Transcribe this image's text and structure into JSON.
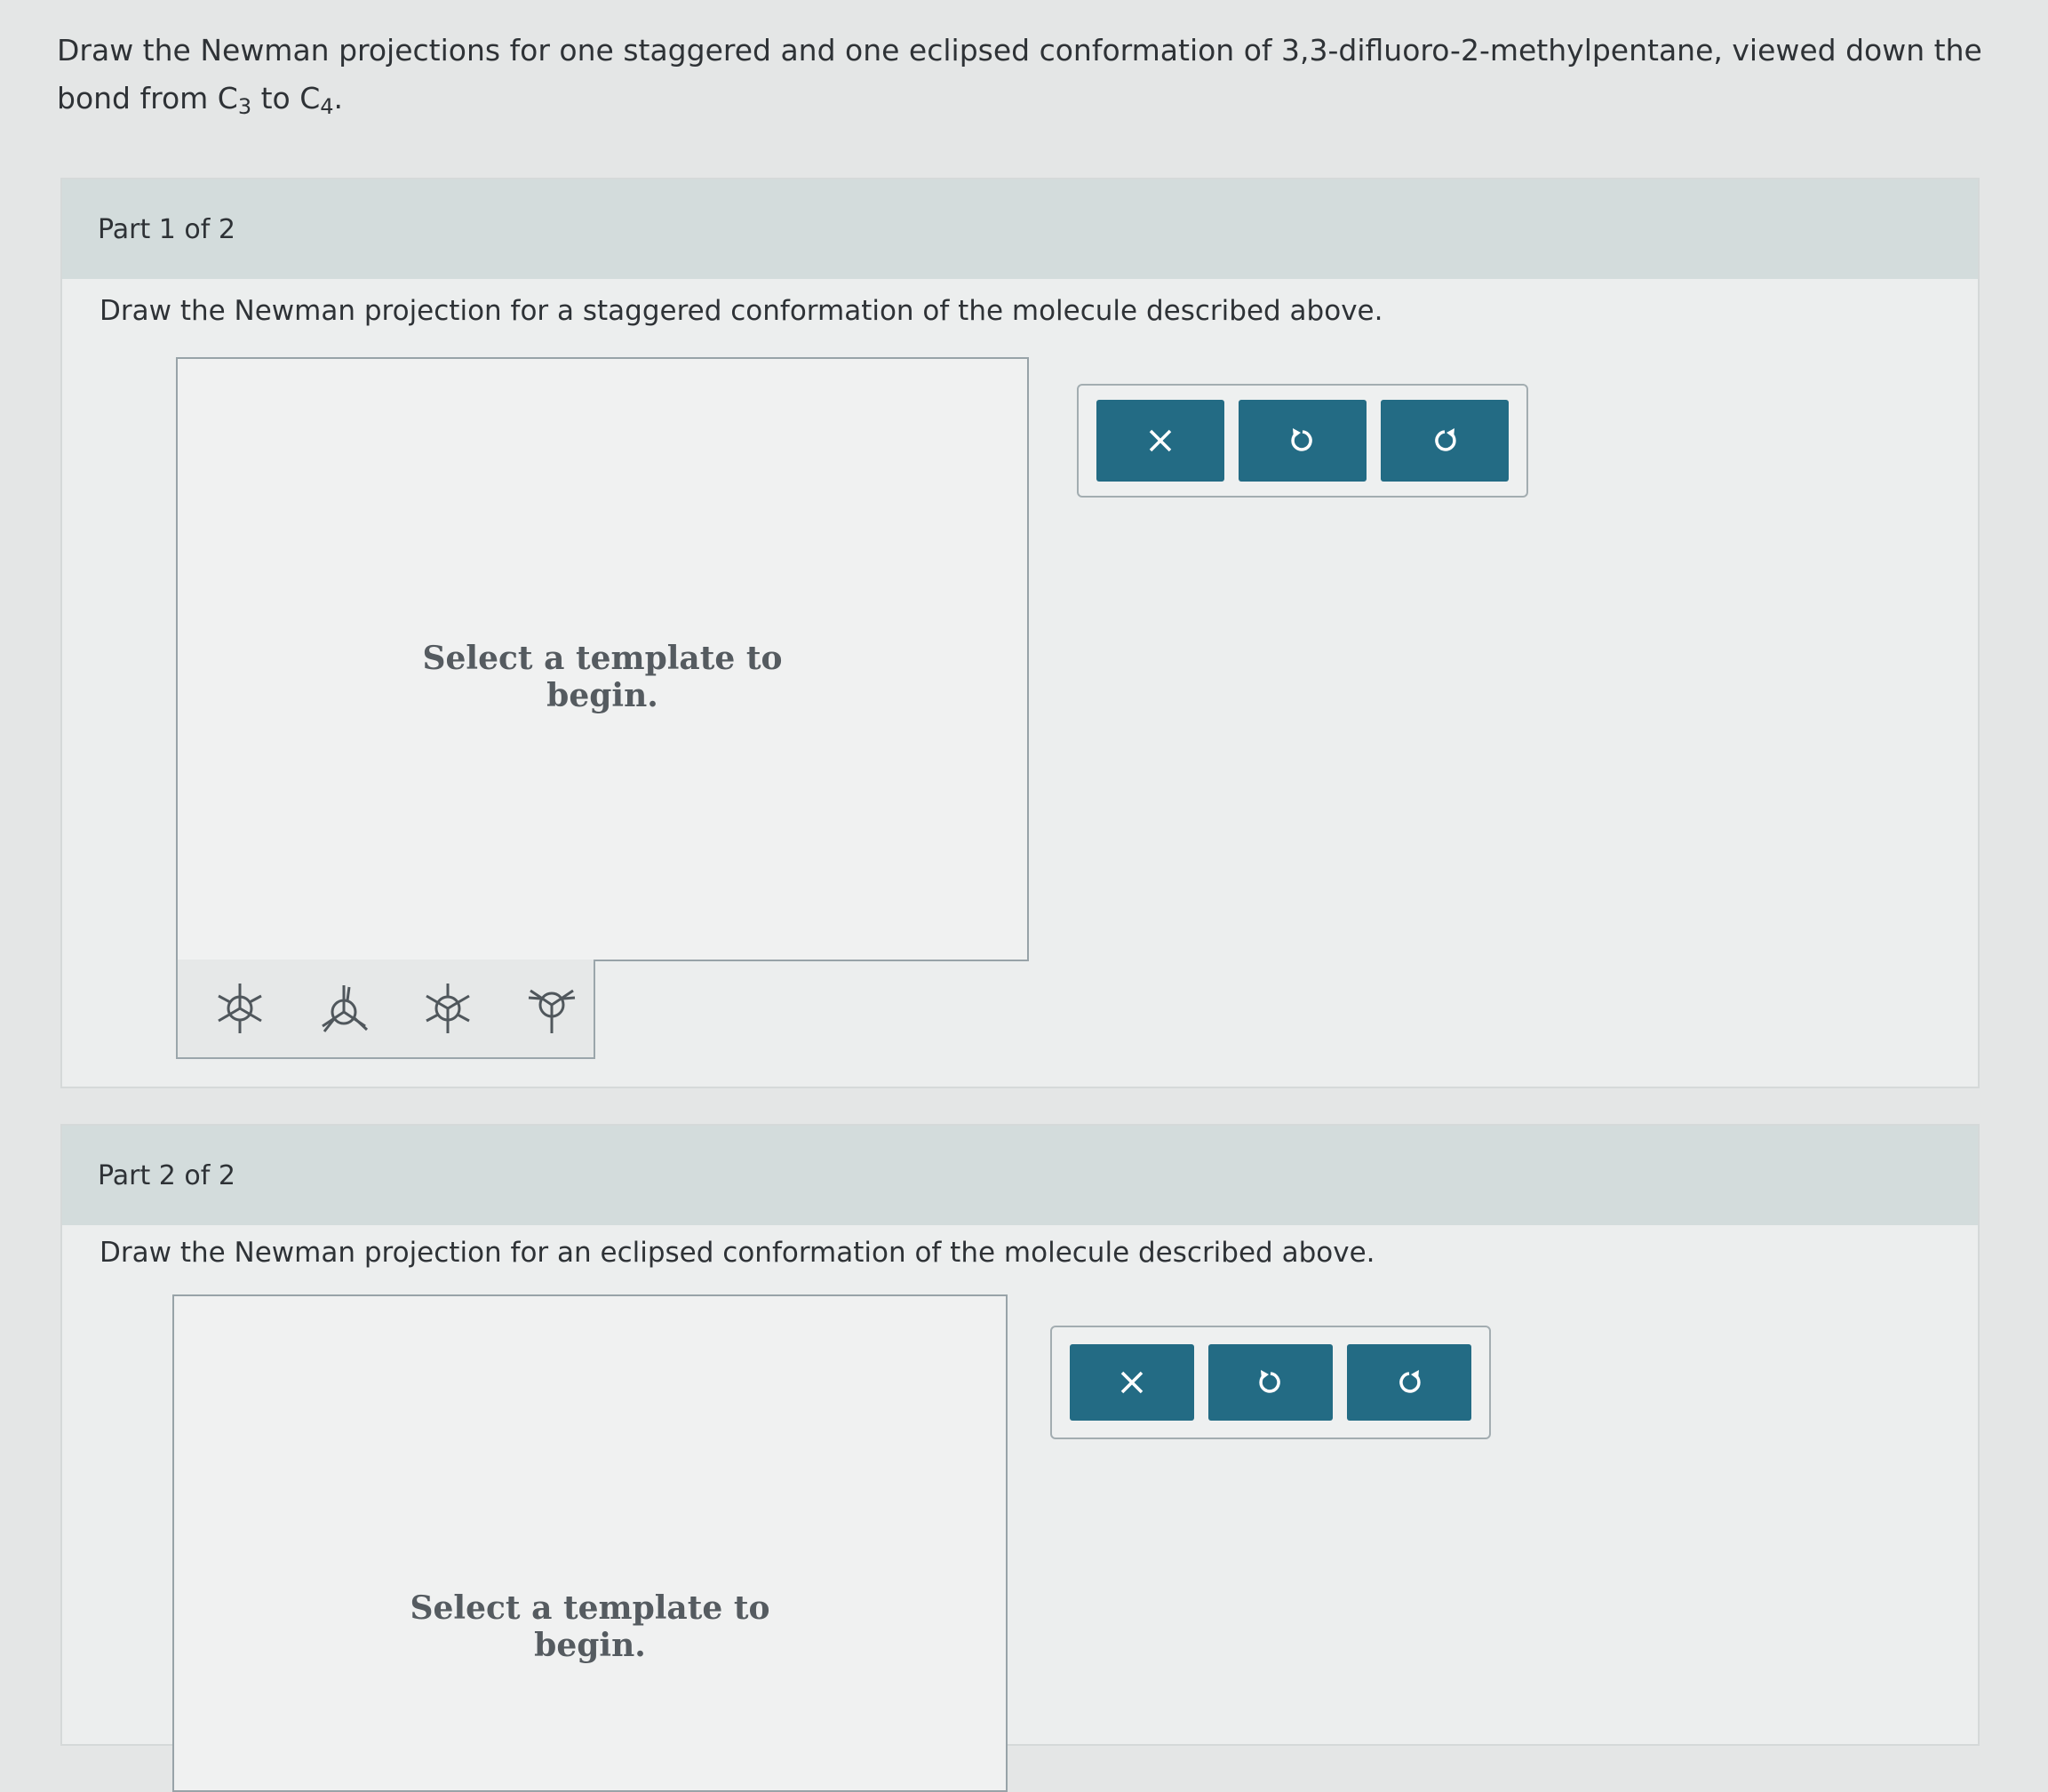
{
  "question": {
    "text_before": "Draw the Newman projections for one staggered and one eclipsed conformation of 3,3-difluoro-2-methylpentane, viewed down the bond from C",
    "sub1": "3",
    "text_mid": " to C",
    "sub2": "4",
    "text_end": "."
  },
  "part1": {
    "header": "Part 1 of 2",
    "instruction": "Draw the Newman projection for a staggered conformation of the molecule described above.",
    "placeholder_line1": "Select a template to",
    "placeholder_line2": "begin.",
    "templates": [
      "staggered-template-icon",
      "eclipsed-template-icon",
      "staggered-alt-template-icon",
      "eclipsed-alt-template-icon"
    ],
    "toolbar": [
      "clear-icon",
      "undo-icon",
      "redo-icon"
    ]
  },
  "part2": {
    "header": "Part 2 of 2",
    "instruction": "Draw the Newman projection for an eclipsed conformation of the molecule described above.",
    "placeholder_line1": "Select a template to",
    "placeholder_line2": "begin.",
    "toolbar": [
      "clear-icon",
      "undo-icon",
      "redo-icon"
    ]
  },
  "colors": {
    "button": "#236b84",
    "header": "#d3dcdc",
    "panel": "#eceeee"
  }
}
